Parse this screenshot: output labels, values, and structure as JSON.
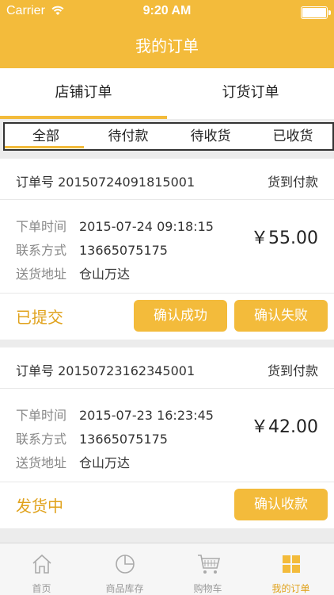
{
  "status_bar": {
    "carrier": "Carrier",
    "time": "9:20 AM"
  },
  "header": {
    "title": "我的订单"
  },
  "segment_tabs": [
    {
      "label": "店铺订单",
      "active": true
    },
    {
      "label": "订货订单",
      "active": false
    }
  ],
  "status_tabs": [
    {
      "label": "全部",
      "active": true
    },
    {
      "label": "待付款",
      "active": false
    },
    {
      "label": "待收货",
      "active": false
    },
    {
      "label": "已收货",
      "active": false
    }
  ],
  "field_labels": {
    "order_time": "下单时间",
    "contact": "联系方式",
    "address": "送货地址"
  },
  "orders": [
    {
      "order_no": "订单号 20150724091815001",
      "pay_type": "货到付款",
      "order_time": "2015-07-24 09:18:15",
      "contact": "13665075175",
      "address": "仓山万达",
      "price": "￥55.00",
      "state": "已提交",
      "buttons": [
        "确认成功",
        "确认失败"
      ]
    },
    {
      "order_no": "订单号 20150723162345001",
      "pay_type": "货到付款",
      "order_time": "2015-07-23 16:23:45",
      "contact": "13665075175",
      "address": "仓山万达",
      "price": "￥42.00",
      "state": "发货中",
      "buttons": [
        "确认收款"
      ]
    }
  ],
  "tabbar": [
    {
      "label": "首页",
      "icon": "home-icon",
      "active": false
    },
    {
      "label": "商品库存",
      "icon": "pie-chart-icon",
      "active": false
    },
    {
      "label": "购物车",
      "icon": "cart-icon",
      "active": false
    },
    {
      "label": "我的订单",
      "icon": "grid-icon",
      "active": true
    }
  ],
  "colors": {
    "accent": "#f3bb3b",
    "state_text": "#e0a21c",
    "background": "#ececec"
  }
}
